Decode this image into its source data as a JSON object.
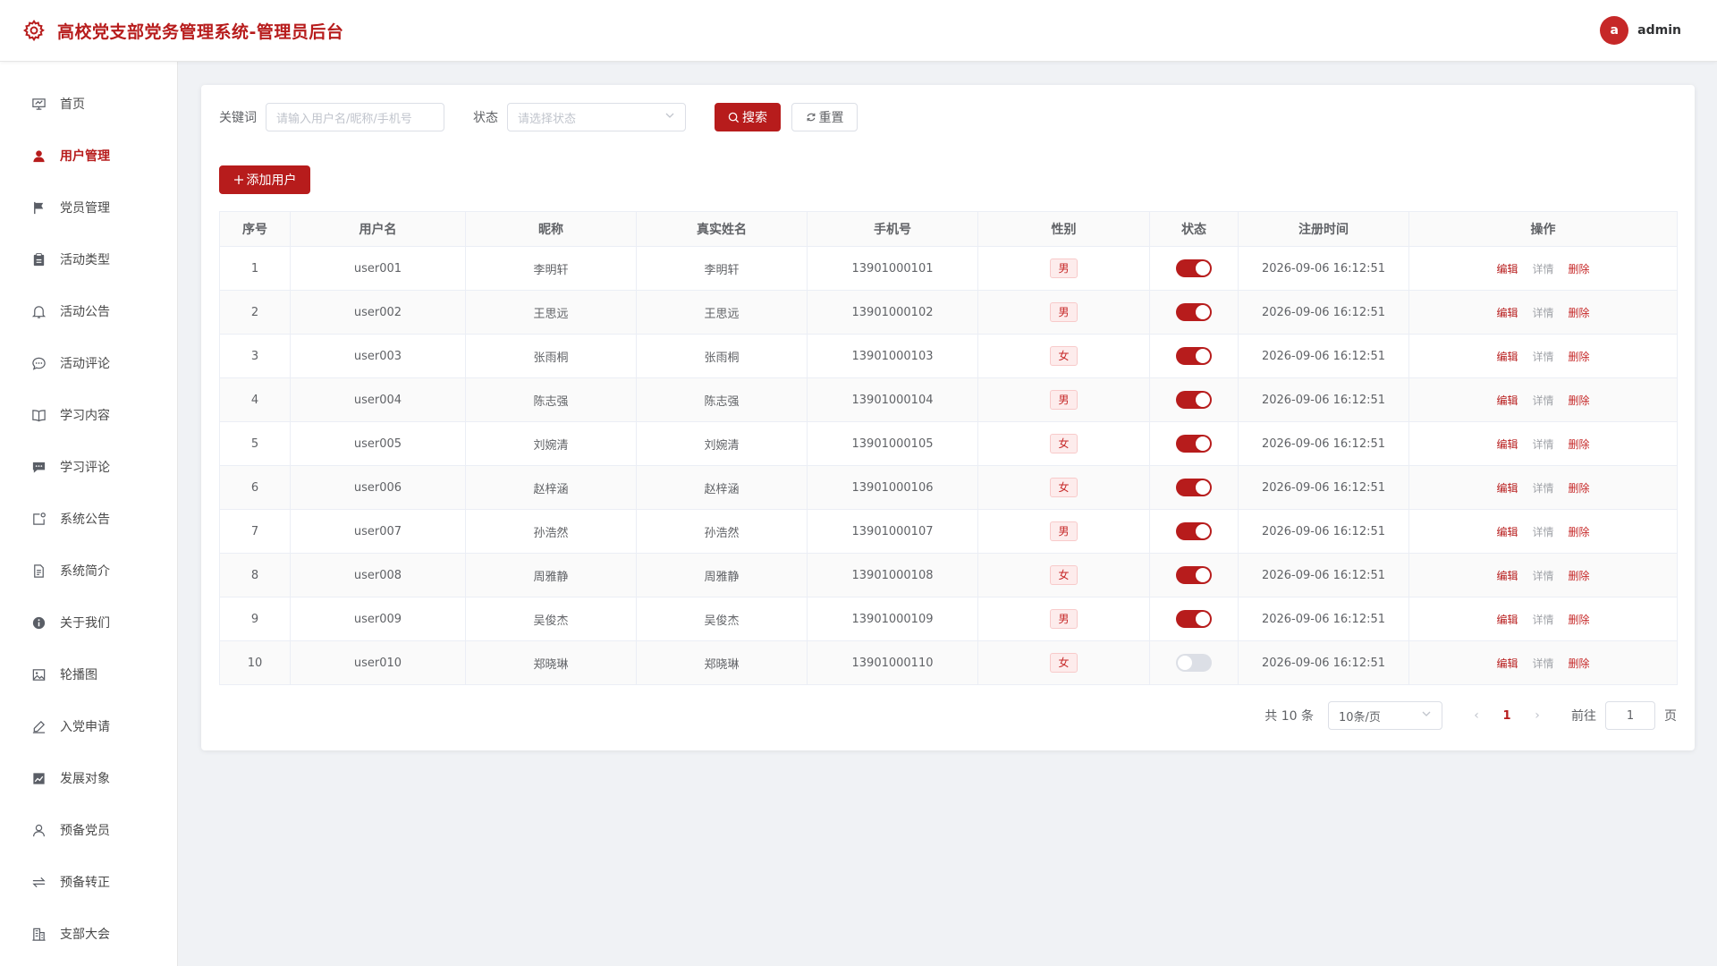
{
  "header": {
    "title": "高校党支部党务管理系统-管理员后台",
    "avatar_letter": "a",
    "username": "admin",
    "brand_color": "#b71c1c"
  },
  "sidebar": {
    "items": [
      {
        "label": "首页",
        "icon": "presentation-icon"
      },
      {
        "label": "用户管理",
        "icon": "user-filled-icon",
        "active": true
      },
      {
        "label": "党员管理",
        "icon": "flag-icon"
      },
      {
        "label": "活动类型",
        "icon": "clipboard-icon"
      },
      {
        "label": "活动公告",
        "icon": "bell-icon"
      },
      {
        "label": "活动评论",
        "icon": "chat-bubble-icon"
      },
      {
        "label": "学习内容",
        "icon": "book-icon"
      },
      {
        "label": "学习评论",
        "icon": "chat-filled-icon"
      },
      {
        "label": "系统公告",
        "icon": "notice-icon"
      },
      {
        "label": "系统简介",
        "icon": "document-icon"
      },
      {
        "label": "关于我们",
        "icon": "info-icon"
      },
      {
        "label": "轮播图",
        "icon": "picture-icon"
      },
      {
        "label": "入党申请",
        "icon": "edit-pen-icon"
      },
      {
        "label": "发展对象",
        "icon": "trend-chart-icon"
      },
      {
        "label": "预备党员",
        "icon": "user-outline-icon"
      },
      {
        "label": "预备转正",
        "icon": "switch-arrows-icon"
      },
      {
        "label": "支部大会",
        "icon": "office-building-icon"
      }
    ]
  },
  "filters": {
    "keyword_label": "关键词",
    "keyword_placeholder": "请输入用户名/昵称/手机号",
    "status_label": "状态",
    "status_placeholder": "请选择状态",
    "search_label": "搜索",
    "reset_label": "重置"
  },
  "toolbar": {
    "add_label": "添加用户"
  },
  "table": {
    "columns": [
      "序号",
      "用户名",
      "昵称",
      "真实姓名",
      "手机号",
      "性别",
      "状态",
      "注册时间",
      "操作"
    ],
    "actions": {
      "edit": "编辑",
      "detail": "详情",
      "delete": "删除"
    },
    "rows": [
      {
        "index": "1",
        "username": "user001",
        "nickname": "李明轩",
        "realname": "李明轩",
        "phone": "13901000101",
        "gender": "男",
        "enabled": true,
        "registered": "2026-09-06 16:12:51"
      },
      {
        "index": "2",
        "username": "user002",
        "nickname": "王思远",
        "realname": "王思远",
        "phone": "13901000102",
        "gender": "男",
        "enabled": true,
        "registered": "2026-09-06 16:12:51"
      },
      {
        "index": "3",
        "username": "user003",
        "nickname": "张雨桐",
        "realname": "张雨桐",
        "phone": "13901000103",
        "gender": "女",
        "enabled": true,
        "registered": "2026-09-06 16:12:51"
      },
      {
        "index": "4",
        "username": "user004",
        "nickname": "陈志强",
        "realname": "陈志强",
        "phone": "13901000104",
        "gender": "男",
        "enabled": true,
        "registered": "2026-09-06 16:12:51"
      },
      {
        "index": "5",
        "username": "user005",
        "nickname": "刘婉清",
        "realname": "刘婉清",
        "phone": "13901000105",
        "gender": "女",
        "enabled": true,
        "registered": "2026-09-06 16:12:51"
      },
      {
        "index": "6",
        "username": "user006",
        "nickname": "赵梓涵",
        "realname": "赵梓涵",
        "phone": "13901000106",
        "gender": "女",
        "enabled": true,
        "registered": "2026-09-06 16:12:51"
      },
      {
        "index": "7",
        "username": "user007",
        "nickname": "孙浩然",
        "realname": "孙浩然",
        "phone": "13901000107",
        "gender": "男",
        "enabled": true,
        "registered": "2026-09-06 16:12:51"
      },
      {
        "index": "8",
        "username": "user008",
        "nickname": "周雅静",
        "realname": "周雅静",
        "phone": "13901000108",
        "gender": "女",
        "enabled": true,
        "registered": "2026-09-06 16:12:51"
      },
      {
        "index": "9",
        "username": "user009",
        "nickname": "吴俊杰",
        "realname": "吴俊杰",
        "phone": "13901000109",
        "gender": "男",
        "enabled": true,
        "registered": "2026-09-06 16:12:51"
      },
      {
        "index": "10",
        "username": "user010",
        "nickname": "郑晓琳",
        "realname": "郑晓琳",
        "phone": "13901000110",
        "gender": "女",
        "enabled": false,
        "registered": "2026-09-06 16:12:51"
      }
    ]
  },
  "pagination": {
    "total_text": "共 10 条",
    "page_size": "10条/页",
    "prev": "‹",
    "current": "1",
    "next": "›",
    "goto_label": "前往",
    "goto_value": "1",
    "page_suffix": "页"
  }
}
